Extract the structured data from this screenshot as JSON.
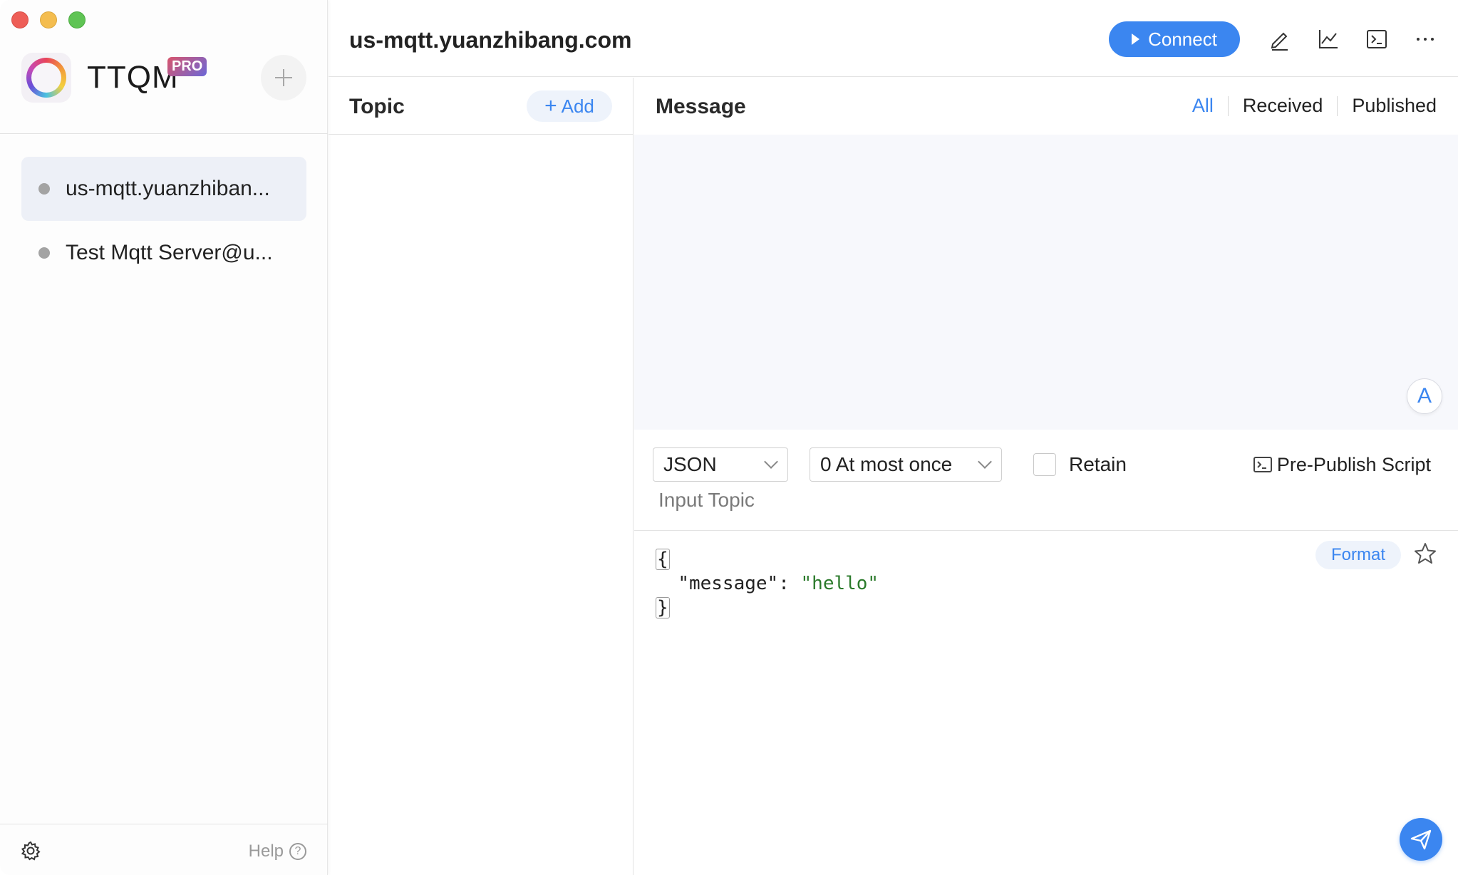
{
  "app": {
    "name": "TTQM",
    "badge": "PRO"
  },
  "sidebar": {
    "connections": [
      {
        "label": "us-mqtt.yuanzhiban...",
        "active": true
      },
      {
        "label": "Test Mqtt Server@u...",
        "active": false
      }
    ],
    "help_label": "Help"
  },
  "header": {
    "title": "us-mqtt.yuanzhibang.com",
    "connect_label": "Connect"
  },
  "topics": {
    "title": "Topic",
    "add_label": "Add"
  },
  "messages": {
    "title": "Message",
    "tabs": [
      {
        "label": "All",
        "active": true
      },
      {
        "label": "Received",
        "active": false
      },
      {
        "label": "Published",
        "active": false
      }
    ],
    "auto_scroll_label": "A"
  },
  "compose": {
    "format_select": "JSON",
    "qos_select": "0 At most once",
    "retain_label": "Retain",
    "retain_checked": false,
    "prepublish_label": "Pre-Publish Script",
    "topic_placeholder": "Input Topic",
    "payload": {
      "open": "{",
      "key": "\"message\"",
      "colon": ":",
      "value": "\"hello\"",
      "close": "}"
    },
    "format_label": "Format"
  },
  "colors": {
    "accent": "#3b86f0",
    "status_dot": "#a3a3a3",
    "string_green": "#2b7a2b"
  }
}
